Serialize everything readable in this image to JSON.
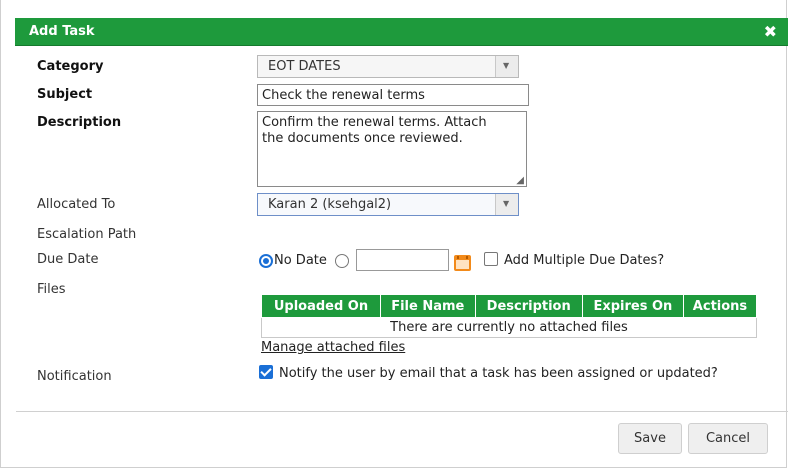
{
  "dialog": {
    "title": "Add Task",
    "close_glyph": "✖"
  },
  "labels": {
    "category": "Category",
    "subject": "Subject",
    "description": "Description",
    "allocated_to": "Allocated To",
    "escalation_path": "Escalation Path",
    "due_date": "Due Date",
    "files": "Files",
    "notification": "Notification"
  },
  "fields": {
    "category_value": "EOT DATES",
    "subject_value": "Check the renewal terms",
    "description_value": "Confirm the renewal terms. Attach\nthe documents once reviewed.",
    "allocated_to_value": "Karan 2 (ksehgal2)",
    "due_date_value": ""
  },
  "due_date": {
    "no_date_label": "No Date",
    "no_date_selected": true,
    "multiple_label": "Add Multiple Due Dates?",
    "multiple_checked": false
  },
  "files_table": {
    "headers": [
      "Uploaded On",
      "File Name",
      "Description",
      "Expires On",
      "Actions"
    ],
    "empty_message": "There are currently no attached files",
    "manage_link": "Manage attached files"
  },
  "notification": {
    "label": "Notify the user by email that a task has been assigned or updated?",
    "checked": true
  },
  "buttons": {
    "save": "Save",
    "cancel": "Cancel"
  },
  "colors": {
    "header_green": "#1e9a3c",
    "accent_blue": "#1a6fd6",
    "calendar_orange": "#f28a1a"
  },
  "icons": {
    "close": "close-icon",
    "calendar": "calendar-icon",
    "dropdown": "chevron-down-icon"
  }
}
